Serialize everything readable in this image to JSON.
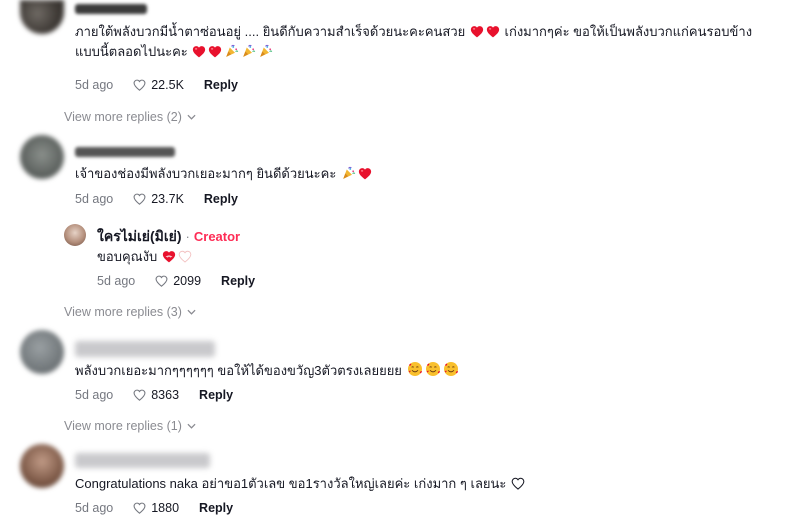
{
  "comments": [
    {
      "text_line1": "ภายใต้พลังบวกมีน้ำตาซ่อนอยู่ .... ยินดีกับความสำเร็จด้วยนะคะคนสวย",
      "text_line1b": "เก่งมากๆค่ะ ขอให้เป็นพลังบวกแก่คนรอบข้าง",
      "text_line2": "แบบนี้ตลอดไปนะคะ",
      "time": "5d ago",
      "likes": "22.5K",
      "reply": "Reply",
      "view_more": "View more replies (2)"
    },
    {
      "text": "เจ้าของช่องมีพลังบวกเยอะมากๆ ยินดีด้วยนะคะ",
      "time": "5d ago",
      "likes": "23.7K",
      "reply": "Reply"
    },
    {
      "creator_reply": {
        "name": "ใครไม่เย่(มิเย่)",
        "separator": "·",
        "badge": "Creator",
        "text": "ขอบคุณงับ",
        "time": "5d ago",
        "likes": "2099",
        "reply": "Reply"
      },
      "view_more": "View more replies (3)"
    },
    {
      "text": "พลังบวกเยอะมากๆๆๆๆๆๆ ขอให้ได้ของขวัญ3ตัวตรงเลยยยย",
      "time": "5d ago",
      "likes": "8363",
      "reply": "Reply",
      "view_more": "View more replies (1)"
    },
    {
      "text": "Congratulations naka อย่าขอ1ตัวเลข ขอ1รางวัลใหญ่เลยค่ะ เก่งมาก ๆ เลยนะ",
      "time": "5d ago",
      "likes": "1880",
      "reply": "Reply"
    }
  ],
  "colors": {
    "accent": "#fe2c55",
    "heart_emoji": "#e8112d",
    "muted": "#757880"
  },
  "icons": [
    "heart-outline-icon",
    "chevron-down-icon",
    "red-heart-emoji",
    "party-popper-emoji",
    "smiling-face-hearts-emoji",
    "heart-with-ribbon-emoji",
    "white-heart-emoji"
  ]
}
